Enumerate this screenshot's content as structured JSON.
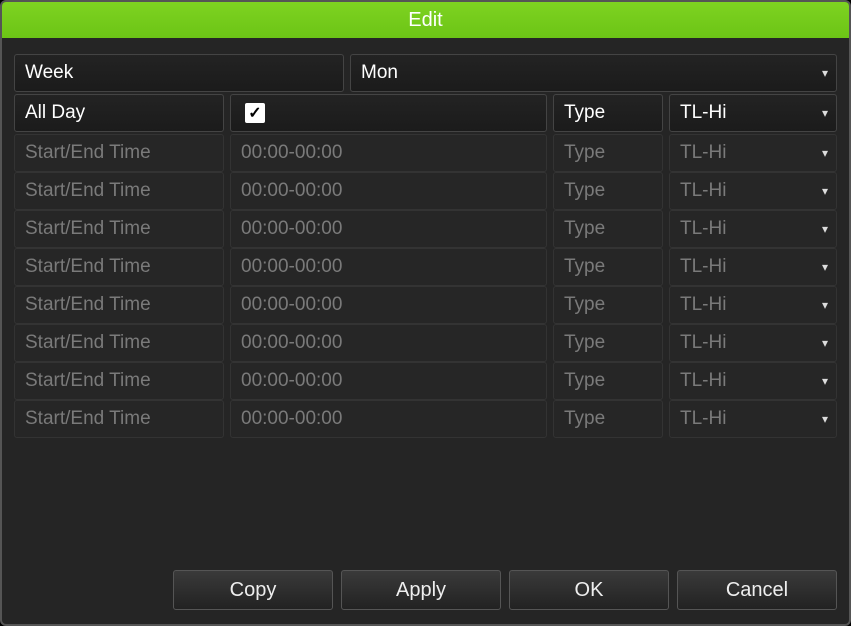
{
  "title": "Edit",
  "week": {
    "label": "Week",
    "value": "Mon"
  },
  "allday": {
    "label": "All Day",
    "checked": true
  },
  "alldayType": {
    "label": "Type",
    "value": "TL-Hi"
  },
  "timeRows": [
    {
      "label": "Start/End Time",
      "time": "00:00-00:00",
      "typeLabel": "Type",
      "typeValue": "TL-Hi"
    },
    {
      "label": "Start/End Time",
      "time": "00:00-00:00",
      "typeLabel": "Type",
      "typeValue": "TL-Hi"
    },
    {
      "label": "Start/End Time",
      "time": "00:00-00:00",
      "typeLabel": "Type",
      "typeValue": "TL-Hi"
    },
    {
      "label": "Start/End Time",
      "time": "00:00-00:00",
      "typeLabel": "Type",
      "typeValue": "TL-Hi"
    },
    {
      "label": "Start/End Time",
      "time": "00:00-00:00",
      "typeLabel": "Type",
      "typeValue": "TL-Hi"
    },
    {
      "label": "Start/End Time",
      "time": "00:00-00:00",
      "typeLabel": "Type",
      "typeValue": "TL-Hi"
    },
    {
      "label": "Start/End Time",
      "time": "00:00-00:00",
      "typeLabel": "Type",
      "typeValue": "TL-Hi"
    },
    {
      "label": "Start/End Time",
      "time": "00:00-00:00",
      "typeLabel": "Type",
      "typeValue": "TL-Hi"
    }
  ],
  "buttons": {
    "copy": "Copy",
    "apply": "Apply",
    "ok": "OK",
    "cancel": "Cancel"
  }
}
